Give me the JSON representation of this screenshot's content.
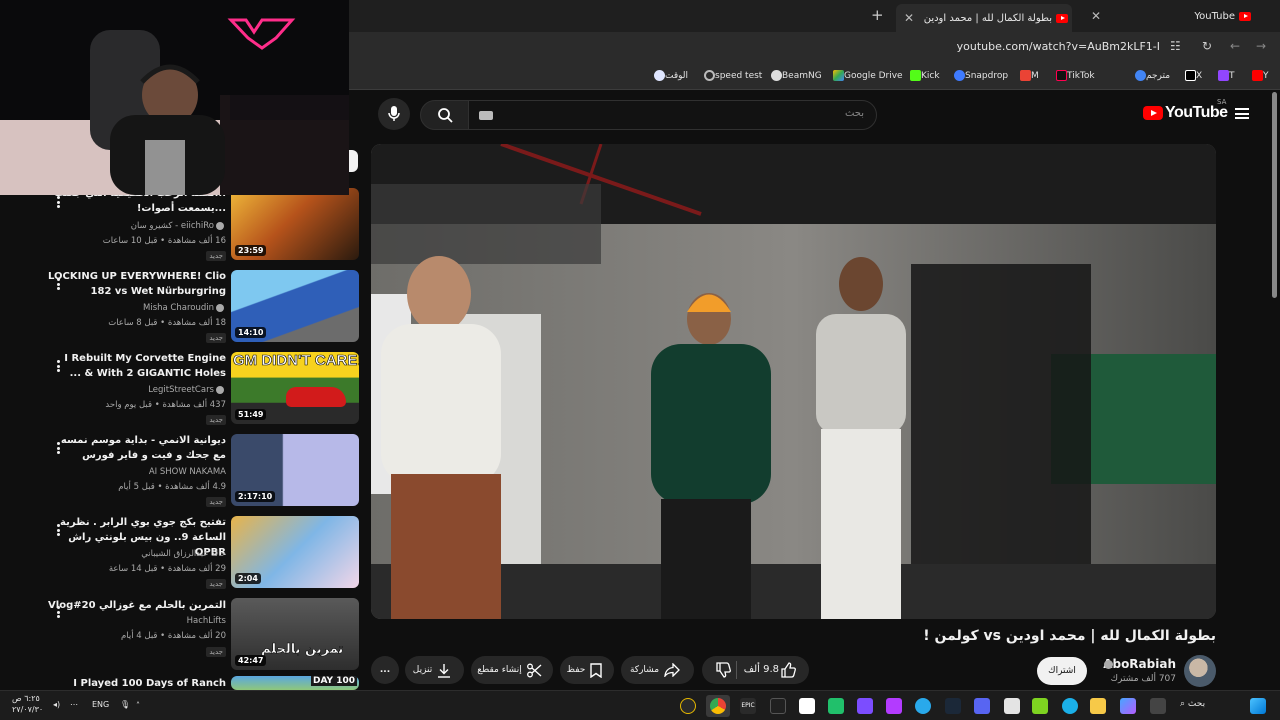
{
  "tabs": [
    {
      "title": "YouTube",
      "active": false
    },
    {
      "title": "بطولة الكمال لله | محمد اودين vs...",
      "active": true
    }
  ],
  "address_bar": {
    "url": "youtube.com/watch?v=AuBm2kLF1-I"
  },
  "bookmarks": [
    {
      "label": "Y",
      "color": "#ff0000"
    },
    {
      "label": "T",
      "color": "#9146ff"
    },
    {
      "label": "X",
      "color": "#ffffff"
    },
    {
      "label": "مترجم",
      "color": "#4285f4"
    },
    {
      "label": "TikTok",
      "color": "#ff0050"
    },
    {
      "label": "M",
      "color": "#ea4335"
    },
    {
      "label": "Snapdrop",
      "color": "#3f7bff"
    },
    {
      "label": "Kick",
      "color": "#53fc18"
    },
    {
      "label": "Google Drive",
      "color": "#34a853"
    },
    {
      "label": "BeamNG",
      "color": "#dddddd"
    },
    {
      "label": "speed test",
      "color": "#bbbbbb"
    },
    {
      "label": "الوقت",
      "color": "#dfe6ff"
    }
  ],
  "masthead": {
    "logo_text": "YouTube",
    "country_code": "SA",
    "search_placeholder": "بحث"
  },
  "video": {
    "title": "بطولة الكمال لله | محمد اودين vs كولمن !",
    "channel": "AboRabiah",
    "subscribers": "707 ألف مشترك",
    "subscribe_label": "اشتراك",
    "likes": "9.8 ألف",
    "share_label": "مشاركة",
    "save_label": "حفظ",
    "clip_label": "إنشاء مقطع",
    "download_label": "تنزيل",
    "more_label": "..."
  },
  "recommendations": [
    {
      "title": "...لقمة الرعب الحقيقية التي جعلت ...يسمعت أصوات!",
      "channel": "eiichiRo - كشيرو سان",
      "meta": "16 ألف مشاهدة • قبل 10 ساعات",
      "duration": "23:59",
      "badge": "جديد"
    },
    {
      "title": "LOCKING UP EVERYWHERE! Clio 182 vs Wet Nürburgring",
      "channel": "Misha Charoudin",
      "meta": "18 ألف مشاهدة • قبل 8 ساعات",
      "duration": "14:10",
      "badge": "جديد"
    },
    {
      "title": "I Rebuilt My Corvette Engine With 2 GIGANTIC Holes & ...",
      "channel": "LegitStreetCars",
      "meta": "437 ألف مشاهدة • قبل يوم واحد",
      "duration": "51:49",
      "badge": "جديد",
      "thumb_text": "GM DIDN'T CARE!"
    },
    {
      "title": "ديوانية الانمي - بداية موسم نمسه مع جحك و فيت و فاير فورس",
      "channel": "AI SHOW NAKAMA",
      "meta": "4.9 ألف مشاهدة • قبل 5 أيام",
      "duration": "2:17:10",
      "badge": "جديد"
    },
    {
      "title": "تفتيح بكج جوي بوي الرابر . نظرية الساعة 9.. ون بيس بلونتي راش OPBR",
      "channel": "خالد عبدالرزاق الشيباني",
      "meta": "29 ألف مشاهدة • قبل 14 ساعة",
      "duration": "2:04",
      "badge": "جديد"
    },
    {
      "title": "التمرين بالحلم مع غوزالي Vlog#20",
      "channel": "HachLifts",
      "meta": "20 ألف مشاهدة • قبل 4 أيام",
      "duration": "42:47",
      "badge": "جديد",
      "thumb_text": "تمرين بالحلم"
    },
    {
      "title": "I Played 100 Days of Ranch",
      "channel": "",
      "meta": "",
      "duration": "",
      "badge": "",
      "thumb_text": "DAY 100"
    }
  ],
  "taskbar": {
    "search_label": "بحث",
    "language": "ENG",
    "time": "٦:٢٥ ص",
    "date": "٢٧/٠٧/٣٠"
  }
}
